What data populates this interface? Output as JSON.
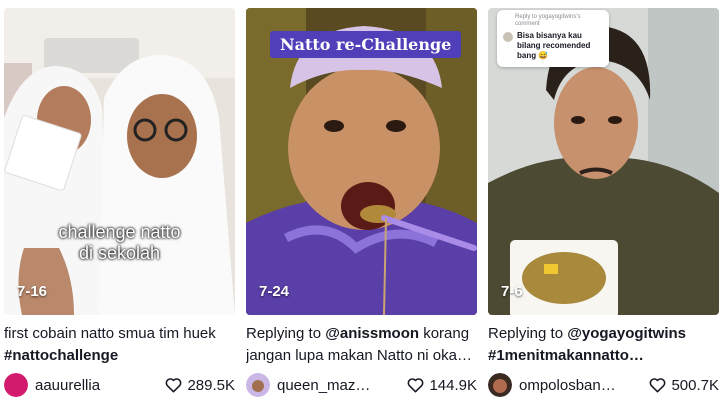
{
  "videos": [
    {
      "date": "7-16",
      "overlay_line1": "challenge natto",
      "overlay_line2": "di sekolah",
      "desc_line1": "first cobain natto smua tim huek",
      "desc_tag": "#nattochallenge",
      "username": "aauurellia",
      "likes": "289.5K",
      "avatar_color": "#d41a6c"
    },
    {
      "date": "7-24",
      "banner": "Natto re-Challenge",
      "reply_prefix": "Replying to ",
      "reply_handle": "@anissmoon",
      "desc_rest": " korang",
      "desc_line2": "jangan lupa makan Natto ni oka…",
      "username": "queen_maz…",
      "likes": "144.9K",
      "avatar_color": "#7a5ccc"
    },
    {
      "date": "7-6",
      "reply_head": "Reply to yogayogitwins's comment",
      "reply_text": "Bisa bisanya kau bilang recomended bang 😅",
      "reply_prefix": "Replying to ",
      "reply_handle": "@yogayogitwins",
      "desc_line2": "#1menitmakannatto…",
      "username": "ompolosban…",
      "likes": "500.7K",
      "avatar_color": "#3a2a22"
    }
  ],
  "icons": {
    "like": "heart-outline-icon"
  }
}
